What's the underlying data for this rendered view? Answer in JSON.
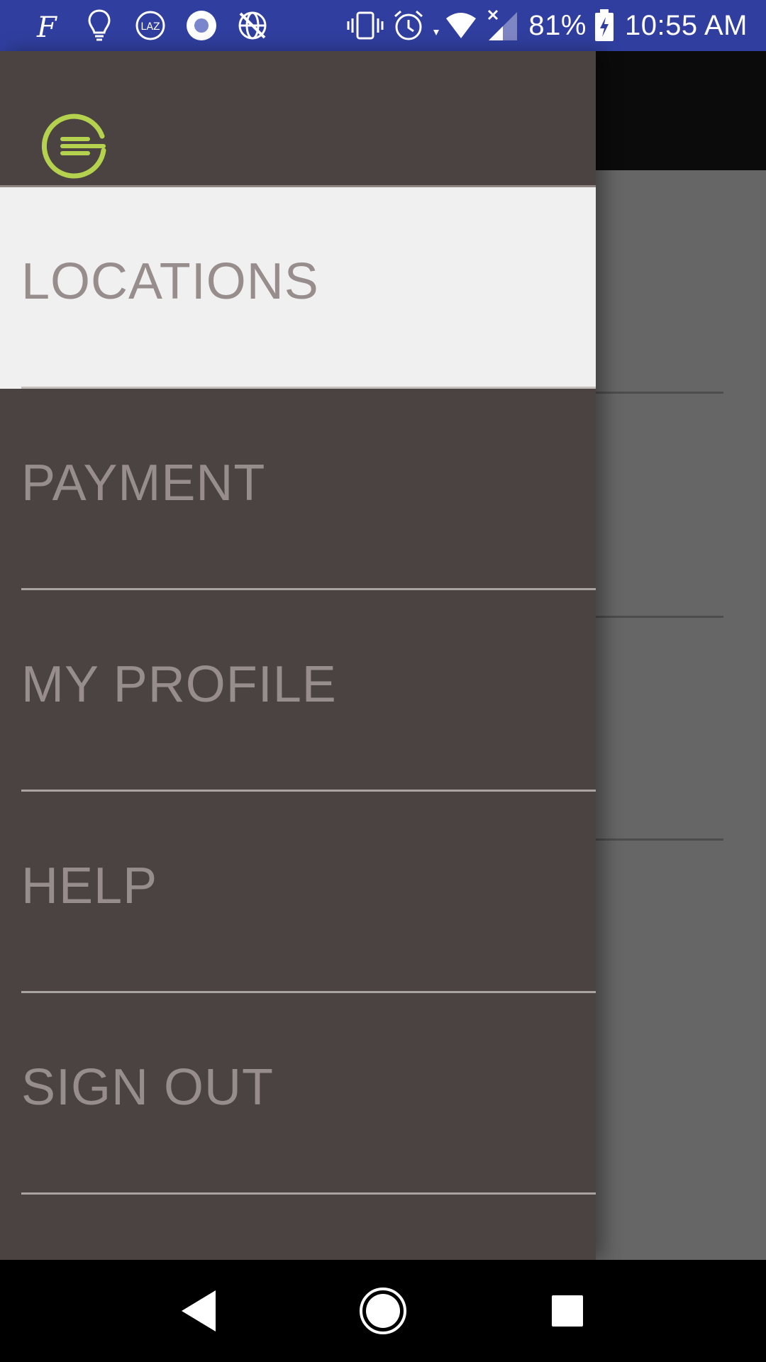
{
  "status_bar": {
    "notification_icons": [
      "fiverr-icon",
      "lightbulb-icon",
      "laz-icon",
      "circle-record-icon",
      "globe-crossed-icon"
    ],
    "system_icons": [
      "vibrate-icon",
      "alarm-icon",
      "wifi-icon",
      "signal-icon"
    ],
    "battery_percent": "81%",
    "time": "10:55 AM",
    "background_color": "#303f9f"
  },
  "drawer": {
    "logo_icon": "brand-g-icon",
    "logo_color": "#b4d24e",
    "background_color": "#4a4341",
    "selected_background_color": "#f0f0f0",
    "label_color": "#978d8c",
    "items": [
      {
        "label": "LOCATIONS",
        "selected": true
      },
      {
        "label": "PAYMENT",
        "selected": false
      },
      {
        "label": "MY PROFILE",
        "selected": false
      },
      {
        "label": "HELP",
        "selected": false
      },
      {
        "label": "SIGN OUT",
        "selected": false
      }
    ]
  },
  "nav_bar": {
    "buttons": [
      "back-icon",
      "home-icon",
      "recents-icon"
    ]
  }
}
